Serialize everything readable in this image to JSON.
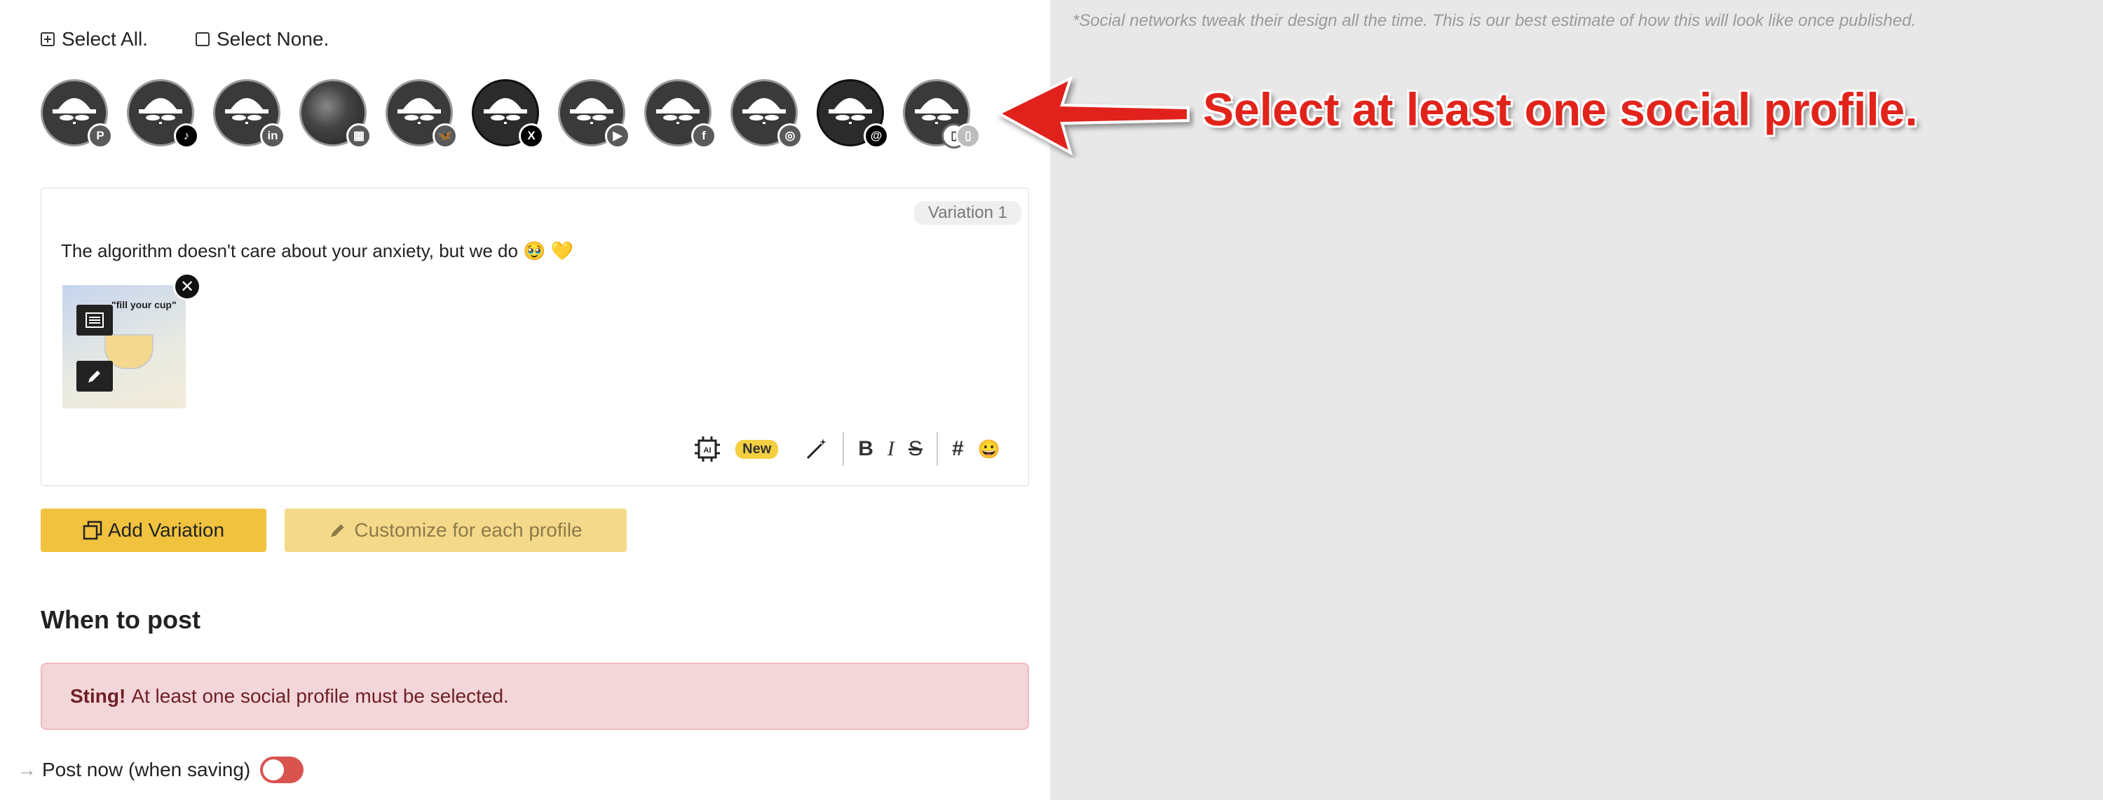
{
  "selection": {
    "select_all": "Select All.",
    "select_none": "Select None."
  },
  "profiles": [
    {
      "network": "pinterest",
      "badge": "P"
    },
    {
      "network": "tiktok",
      "badge": "♪"
    },
    {
      "network": "linkedin",
      "badge": "in"
    },
    {
      "network": "google-business",
      "badge": "▦"
    },
    {
      "network": "bluesky",
      "badge": "🦋"
    },
    {
      "network": "x",
      "badge": "X"
    },
    {
      "network": "youtube",
      "badge": "▶"
    },
    {
      "network": "facebook",
      "badge": "f"
    },
    {
      "network": "instagram",
      "badge": "◎"
    },
    {
      "network": "threads",
      "badge": "@"
    },
    {
      "network": "mobile",
      "badge": "▯"
    }
  ],
  "preview_note": "*Social networks tweak their design all the time. This is our best estimate of how this will look like once published.",
  "callout": "Select at least one social profile.",
  "editor": {
    "variation_label": "Variation 1",
    "post_text": "The algorithm doesn't care about your anxiety, but we do 🥹 💛",
    "image_title": "\"fill your cup\"",
    "new_badge": "New",
    "bold": "B",
    "italic": "I",
    "strike": "S",
    "hashtag": "#",
    "emoji": "😀",
    "ai_label": "AI"
  },
  "buttons": {
    "add_variation": "Add Variation",
    "customize": "Customize for each profile"
  },
  "when_to_post": {
    "title": "When to post",
    "alert_strong": "Sting!",
    "alert_text": "At least one social profile must be selected.",
    "post_now": "Post now (when saving)"
  },
  "colors": {
    "accent": "#f0c23e",
    "alert_bg": "#f3d6da",
    "callout": "#e1241b",
    "toggle": "#d9534f"
  }
}
